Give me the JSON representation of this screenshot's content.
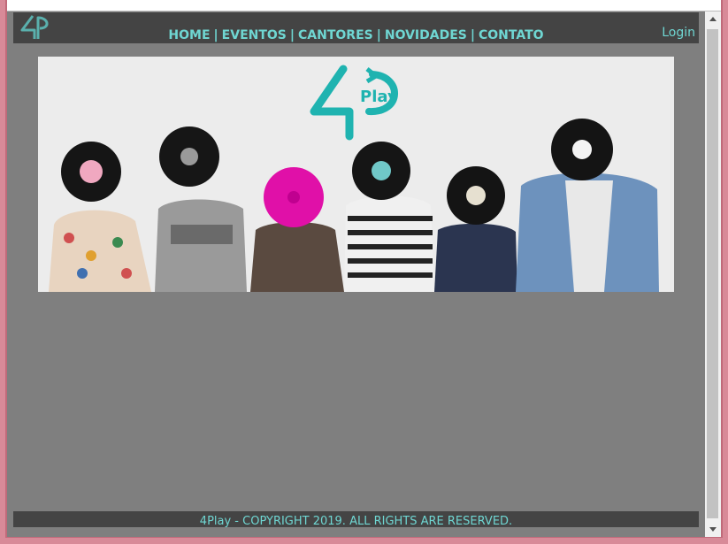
{
  "nav": {
    "items": [
      "HOME",
      "EVENTOS",
      "CANTORES",
      "NOVIDADES",
      "CONTATO"
    ],
    "separator": "|",
    "login_label": "Login"
  },
  "banner": {
    "logo_text": "Play"
  },
  "footer": {
    "copyright": "4Play - COPYRIGHT 2019. ALL RIGHTS ARE RESERVED."
  },
  "icons": {
    "small_logo": "4p-logo-icon",
    "scroll_up": "scroll-up-arrow-icon",
    "scroll_down": "scroll-down-arrow-icon"
  },
  "colors": {
    "accent": "#6fd6d2",
    "navbar": "#444444",
    "page_bg": "#7f7f7f",
    "frame": "#d88a98"
  }
}
